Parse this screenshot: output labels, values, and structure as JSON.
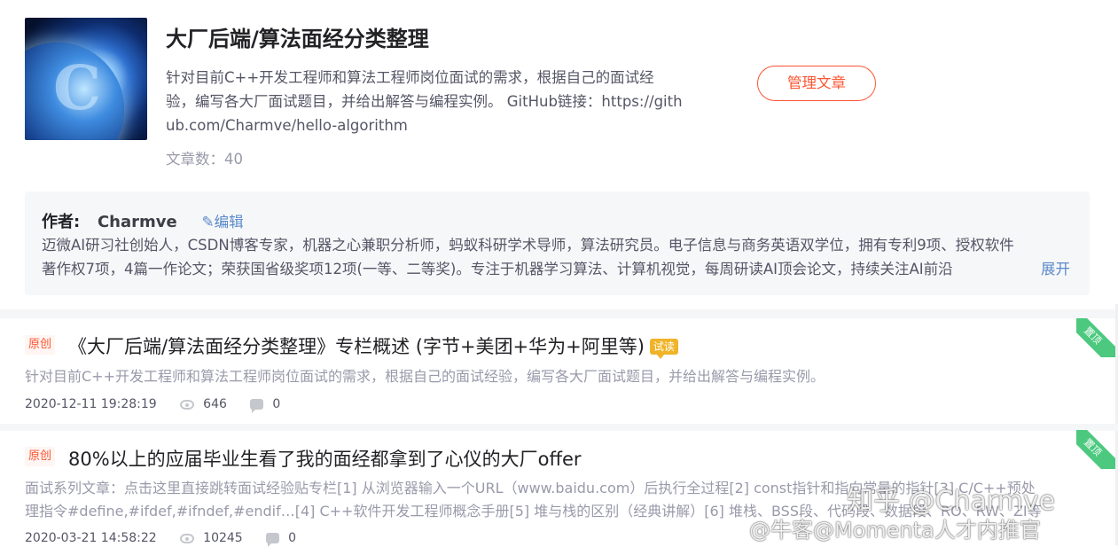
{
  "column": {
    "title": "大厂后端/算法面经分类整理",
    "description": "针对目前C++开发工程师和算法工程师岗位面试的需求，根据自己的面试经验，编写各大厂面试题目，并给出解答与编程实例。 GitHub链接：https://github.com/Charmve/hello-algorithm",
    "description_lines": [
      "针对目前C++开发工程师和算法工程师岗位面试的需求，根据自己的面试经",
      "验，编写各大厂面试题目，并给出解答与编程实例。 GitHub链接：https://gith",
      "ub.com/Charmve/hello-algorithm"
    ],
    "article_count_label": "文章数：",
    "article_count": "40",
    "manage_button": "管理文章"
  },
  "author": {
    "label": "作者:",
    "name": "Charmve",
    "edit_label": "编辑",
    "bio_line1": "迈微AI研习社创始人，CSDN博客专家，机器之心兼职分析师，蚂蚁科研学术导师，算法研究员。电子信息与商务英语双学位，拥有专利9项、授权软件",
    "bio_line2": "著作权7项，4篇一作论文；荣获国省级奖项12项(一等、二等奖)。专注于机器学习算法、计算机视觉，每周研读AI顶会论文，持续关注AI前沿",
    "expand_label": "展开"
  },
  "articles": [
    {
      "tag": "原创",
      "title": "《大厂后端/算法面经分类整理》专栏概述 (字节+美团+华为+阿里等)",
      "trial_tag": "试读",
      "desc": "针对目前C++开发工程师和算法工程师岗位面试的需求，根据自己的面试经验，编写各大厂面试题目，并给出解答与编程实例。",
      "date": "2020-12-11 19:28:19",
      "views": "646",
      "comments": "0",
      "pin_label": "置顶"
    },
    {
      "tag": "原创",
      "title": "80%以上的应届毕业生看了我的面经都拿到了心仪的大厂offer",
      "desc_line1": "面试系列文章：点击这里直接跳转面试经验贴专栏[1] 从浏览器输入一个URL（www.baidu.com）后执行全过程[2] const指针和指向常量的指针[3] C/C++预处",
      "desc_line2": "理指令#define,#ifdef,#ifndef,#endif…[4] C++软件开发工程师概念手册[5] 堆与栈的区别（经典讲解）[6] 堆栈、BSS段、代码段、数据段、RO、RW、ZI等",
      "date": "2020-03-21 14:58:22",
      "views": "10245",
      "comments": "0",
      "pin_label": "置顶"
    }
  ],
  "watermarks": {
    "zhihu": "知乎 @Charmve",
    "nowcoder": "@牛客@Momenta人才内推官"
  },
  "colors": {
    "accent": "#fc5531",
    "link": "#5b8ac9",
    "pin": "#4cc97f",
    "trial": "#f0b429"
  }
}
